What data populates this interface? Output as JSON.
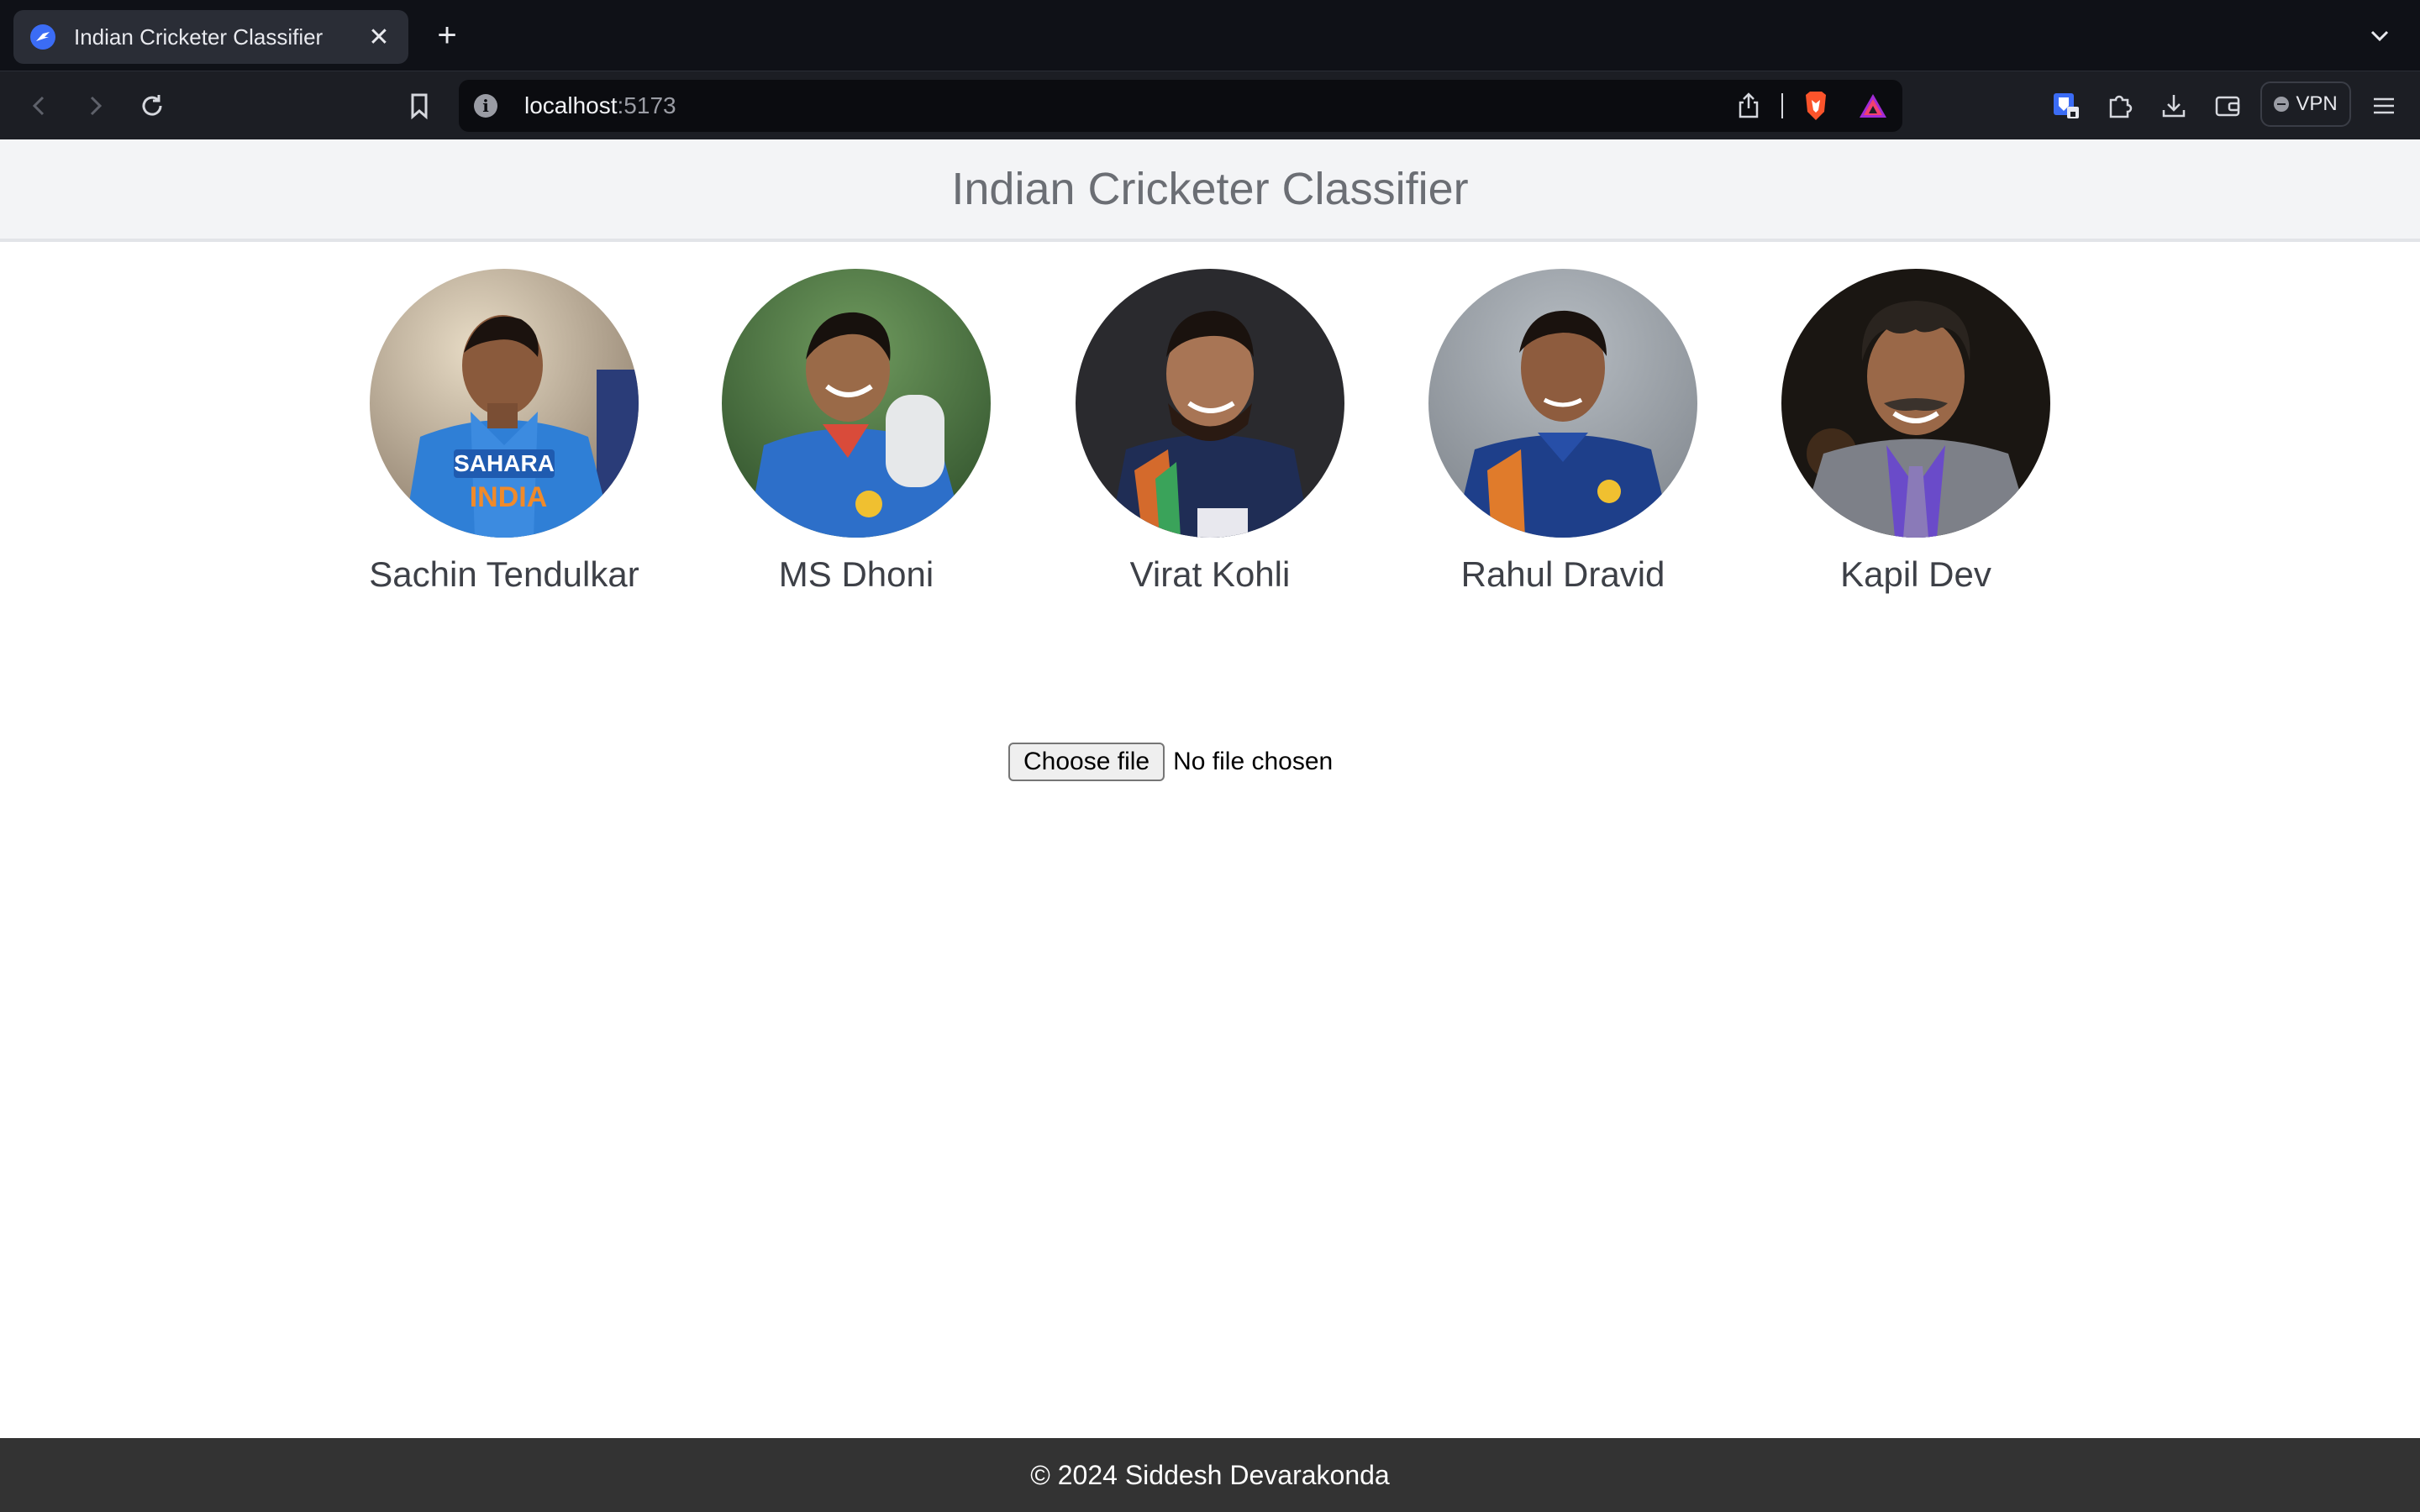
{
  "browser": {
    "tab_title": "Indian Cricketer Classifier",
    "url_host": "localhost",
    "url_port": ":5173",
    "vpn_label": "VPN",
    "icons": [
      "back-icon",
      "forward-icon",
      "reload-icon",
      "bookmark-icon",
      "info-icon",
      "share-icon",
      "brave-shield-icon",
      "brave-rewards-icon",
      "bitwarden-icon",
      "extensions-icon",
      "downloads-icon",
      "wallet-icon",
      "menu-icon"
    ]
  },
  "header": {
    "title": "Indian Cricketer Classifier"
  },
  "players": [
    {
      "name": "Sachin Tendulkar"
    },
    {
      "name": "MS Dhoni"
    },
    {
      "name": "Virat Kohli"
    },
    {
      "name": "Rahul Dravid"
    },
    {
      "name": "Kapil Dev"
    }
  ],
  "upload": {
    "button_label": "Choose file",
    "status": "No file chosen"
  },
  "footer": {
    "text": "© 2024 Siddesh Devarakonda"
  }
}
